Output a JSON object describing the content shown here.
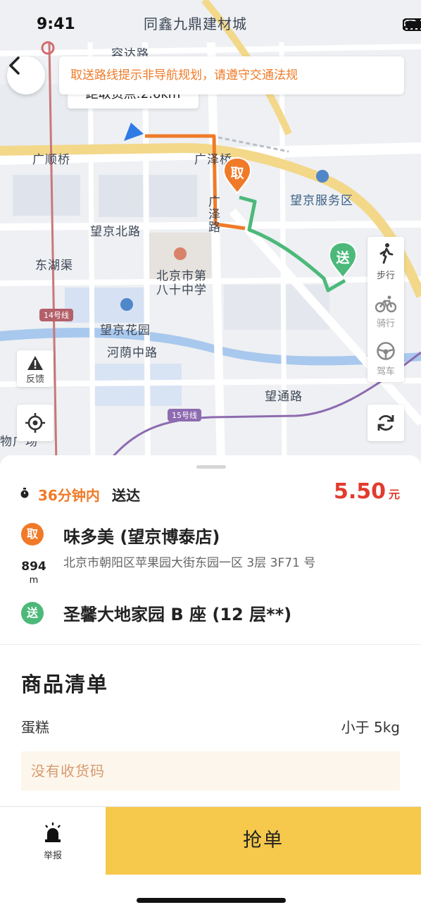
{
  "status_bar": {
    "time": "9:41",
    "map_top_label": "同鑫九鼎建材城"
  },
  "map": {
    "notice": "取送路线提示非导航规划，请遵守交通法规",
    "distance_tip": "距取货点:2.6km",
    "labels": {
      "rongda_road": "容达路",
      "guang": "广",
      "guangshun_bridge": "广顺桥",
      "guangze_bridge": "广泽桥",
      "guangze_road_v": "广泽路",
      "wangjing_north_road": "望京北路",
      "donghuqu": "东湖渠",
      "school": "北京市第八十中学",
      "wangjing_garden": "望京花园",
      "heyin_middle_road": "河荫中路",
      "wangjing_service": "望京服务区",
      "wangtong_road": "望通路",
      "plaza": "物广场"
    },
    "lines": {
      "line14": "14号线",
      "line15": "15号线"
    },
    "pins": {
      "pickup": "取",
      "dropoff": "送"
    },
    "modes": [
      {
        "label": "步行",
        "icon": "walk-icon"
      },
      {
        "label": "骑行",
        "icon": "bike-icon"
      },
      {
        "label": "驾车",
        "icon": "steering-wheel-icon"
      }
    ],
    "feedback_label": "反馈",
    "colors": {
      "pickup_route": "#f07a28",
      "dropoff_route": "#4cb97a",
      "accent": "#f07a28"
    }
  },
  "order": {
    "eta_value": "36分钟内",
    "eta_suffix": "送达",
    "price": "5.50",
    "price_unit": "元",
    "pickup_badge": "取",
    "pickup_name": "味多美 (望京博泰店)",
    "pickup_address": "北京市朝阳区苹果园大街东园一区 3层 3F71 号",
    "distance_value": "894",
    "distance_unit": "m",
    "dropoff_badge": "送",
    "dropoff_name": "圣馨大地家园 B 座 (12 层**)"
  },
  "goods": {
    "title": "商品清单",
    "items": [
      {
        "name": "蛋糕",
        "weight": "小于 5kg"
      }
    ],
    "no_code": "没有收货码"
  },
  "actions": {
    "report_label": "举报",
    "grab_label": "抢单"
  }
}
